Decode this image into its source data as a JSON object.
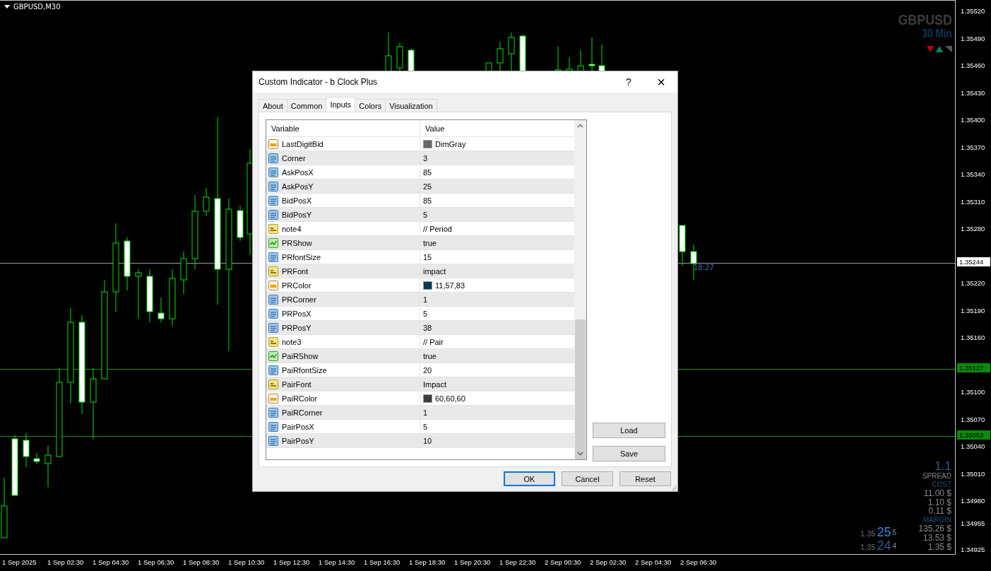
{
  "chart": {
    "symbol_label": "GBPUSD,M30",
    "pair_title": "GBPUSD",
    "period_title": "30 Min",
    "timer": "18:27",
    "signals": [
      {
        "kind": "down",
        "color": "#b80000"
      },
      {
        "kind": "up",
        "color": "#00866a"
      },
      {
        "kind": "corner",
        "color": "#5a5a5a"
      }
    ],
    "price_ticks": [
      "1.35520",
      "1.35490",
      "1.35460",
      "1.35430",
      "1.35400",
      "1.35370",
      "1.35340",
      "1.35310",
      "1.35280",
      "1.35220",
      "1.35190",
      "1.35160",
      "1.35100",
      "1.35070",
      "1.35040",
      "1.35010",
      "1.34980",
      "1.34955",
      "1.34925"
    ],
    "price_markers": [
      {
        "text": "1.35244",
        "kind": "bid"
      },
      {
        "text": "1.35127",
        "kind": "level"
      },
      {
        "text": "1.35053",
        "kind": "level"
      }
    ],
    "time_ticks": [
      "1 Sep 2025",
      "1 Sep 02:30",
      "1 Sep 04:30",
      "1 Sep 06:30",
      "1 Sep 08:30",
      "1 Sep 10:30",
      "1 Sep 12:30",
      "1 Sep 14:30",
      "1 Sep 16:30",
      "1 Sep 18:30",
      "1 Sep 20:30",
      "1 Sep 22:30",
      "2 Sep 00:30",
      "2 Sep 02:30",
      "2 Sep 04:30",
      "2 Sep 06:30"
    ],
    "info": {
      "spread_value": "1.1",
      "spread_label": "SPREAD",
      "cost_label": "COST",
      "costs": [
        "11.00 $",
        "1.10 $",
        "0.11 $"
      ],
      "margin_label": "MARGIN",
      "margins": [
        "135.26 $",
        "13.53 $",
        "1.35 $"
      ]
    },
    "quotes": [
      {
        "kind": "ask",
        "prefix": "1.35",
        "big": "25",
        "small": "5"
      },
      {
        "kind": "bid",
        "prefix": "1.35",
        "big": "24",
        "small": "4"
      }
    ]
  },
  "dialog": {
    "title": "Custom Indicator - b Clock Plus",
    "help": "?",
    "close": "×",
    "tabs": [
      {
        "label": "About",
        "selected": false
      },
      {
        "label": "Common",
        "selected": false
      },
      {
        "label": "Inputs",
        "selected": true
      },
      {
        "label": "Colors",
        "selected": false
      },
      {
        "label": "Visualization",
        "selected": false
      }
    ],
    "columns": [
      "Variable",
      "Value"
    ],
    "rows": [
      {
        "kind": "color",
        "variable": "LastDigitBid",
        "value": "DimGray",
        "color": "#696969"
      },
      {
        "kind": "int",
        "variable": "Corner",
        "value": "3"
      },
      {
        "kind": "int",
        "variable": "AskPosX",
        "value": "85"
      },
      {
        "kind": "int",
        "variable": "AskPosY",
        "value": "25"
      },
      {
        "kind": "int",
        "variable": "BidPosX",
        "value": "85"
      },
      {
        "kind": "int",
        "variable": "BidPosY",
        "value": "5"
      },
      {
        "kind": "string",
        "variable": "note4",
        "value": "// Period"
      },
      {
        "kind": "bool",
        "variable": "PRShow",
        "value": "true"
      },
      {
        "kind": "int",
        "variable": "PRfontSize",
        "value": "15"
      },
      {
        "kind": "string",
        "variable": "PRFont",
        "value": "impact"
      },
      {
        "kind": "color",
        "variable": "PRColor",
        "value": "11,57,83",
        "color": "#0b3953"
      },
      {
        "kind": "int",
        "variable": "PRCorner",
        "value": "1"
      },
      {
        "kind": "int",
        "variable": "PRPosX",
        "value": "5"
      },
      {
        "kind": "int",
        "variable": "PRPosY",
        "value": "38"
      },
      {
        "kind": "string",
        "variable": "note3",
        "value": "// Pair"
      },
      {
        "kind": "bool",
        "variable": "PaiRShow",
        "value": "true"
      },
      {
        "kind": "int",
        "variable": "PaiRfontSize",
        "value": "20"
      },
      {
        "kind": "string",
        "variable": "PairFont",
        "value": "Impact"
      },
      {
        "kind": "color",
        "variable": "PaiRColor",
        "value": "60,60,60",
        "color": "#3c3c3c"
      },
      {
        "kind": "int",
        "variable": "PaiRCorner",
        "value": "1"
      },
      {
        "kind": "int",
        "variable": "PairPosX",
        "value": "5"
      },
      {
        "kind": "int",
        "variable": "PairPosY",
        "value": "10"
      }
    ],
    "side_buttons": [
      "Load",
      "Save"
    ],
    "buttons": [
      {
        "label": "OK",
        "default": true
      },
      {
        "label": "Cancel",
        "default": false
      },
      {
        "label": "Reset",
        "default": false
      }
    ]
  }
}
